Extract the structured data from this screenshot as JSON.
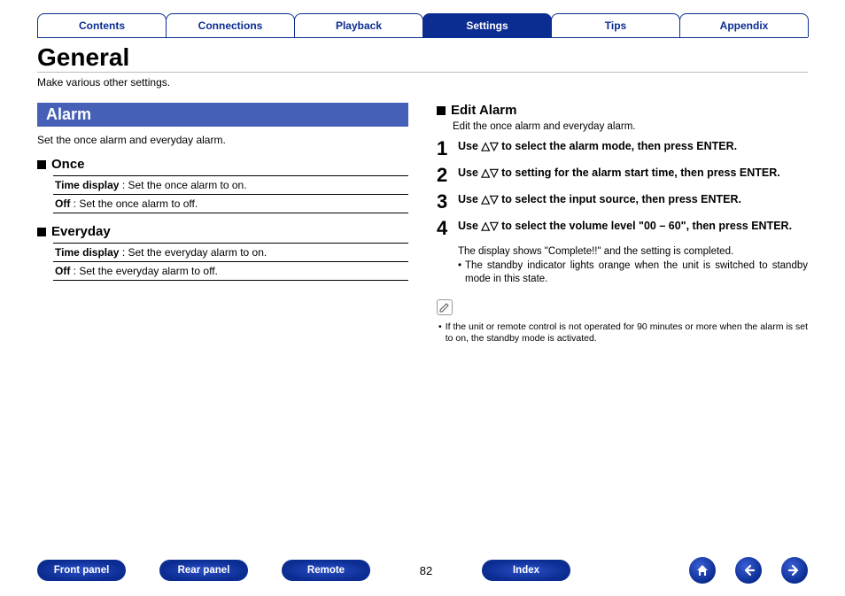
{
  "nav": {
    "tabs": [
      "Contents",
      "Connections",
      "Playback",
      "Settings",
      "Tips",
      "Appendix"
    ],
    "active_index": 3
  },
  "title": "General",
  "subtitle": "Make various other settings.",
  "left": {
    "section_header": "Alarm",
    "section_desc": "Set the once alarm and everyday alarm.",
    "once": {
      "heading": "Once",
      "rows": [
        {
          "k": "Time display",
          "v": " : Set the once alarm to on."
        },
        {
          "k": "Off",
          "v": " : Set the once alarm to off."
        }
      ]
    },
    "everyday": {
      "heading": "Everyday",
      "rows": [
        {
          "k": "Time display",
          "v": " : Set the everyday alarm to on."
        },
        {
          "k": "Off",
          "v": " : Set the everyday alarm to off."
        }
      ]
    }
  },
  "right": {
    "heading": "Edit Alarm",
    "desc": "Edit the once alarm and everyday alarm.",
    "steps": [
      "Use △▽ to select the alarm mode, then press ENTER.",
      "Use △▽ to setting for the alarm start time, then press ENTER.",
      "Use △▽ to select the input source, then press ENTER.",
      "Use △▽ to select the volume level \"00 – 60\", then press ENTER."
    ],
    "after1": "The display shows \"Complete!!\" and the setting is completed.",
    "after2": "The standby indicator lights orange when the unit is switched to standby mode in this state.",
    "note": "If the unit or remote control is not operated for 90 minutes or more when the alarm is set to on, the standby mode is activated."
  },
  "bottom": {
    "front": "Front panel",
    "rear": "Rear panel",
    "remote": "Remote",
    "page": "82",
    "index": "Index"
  }
}
